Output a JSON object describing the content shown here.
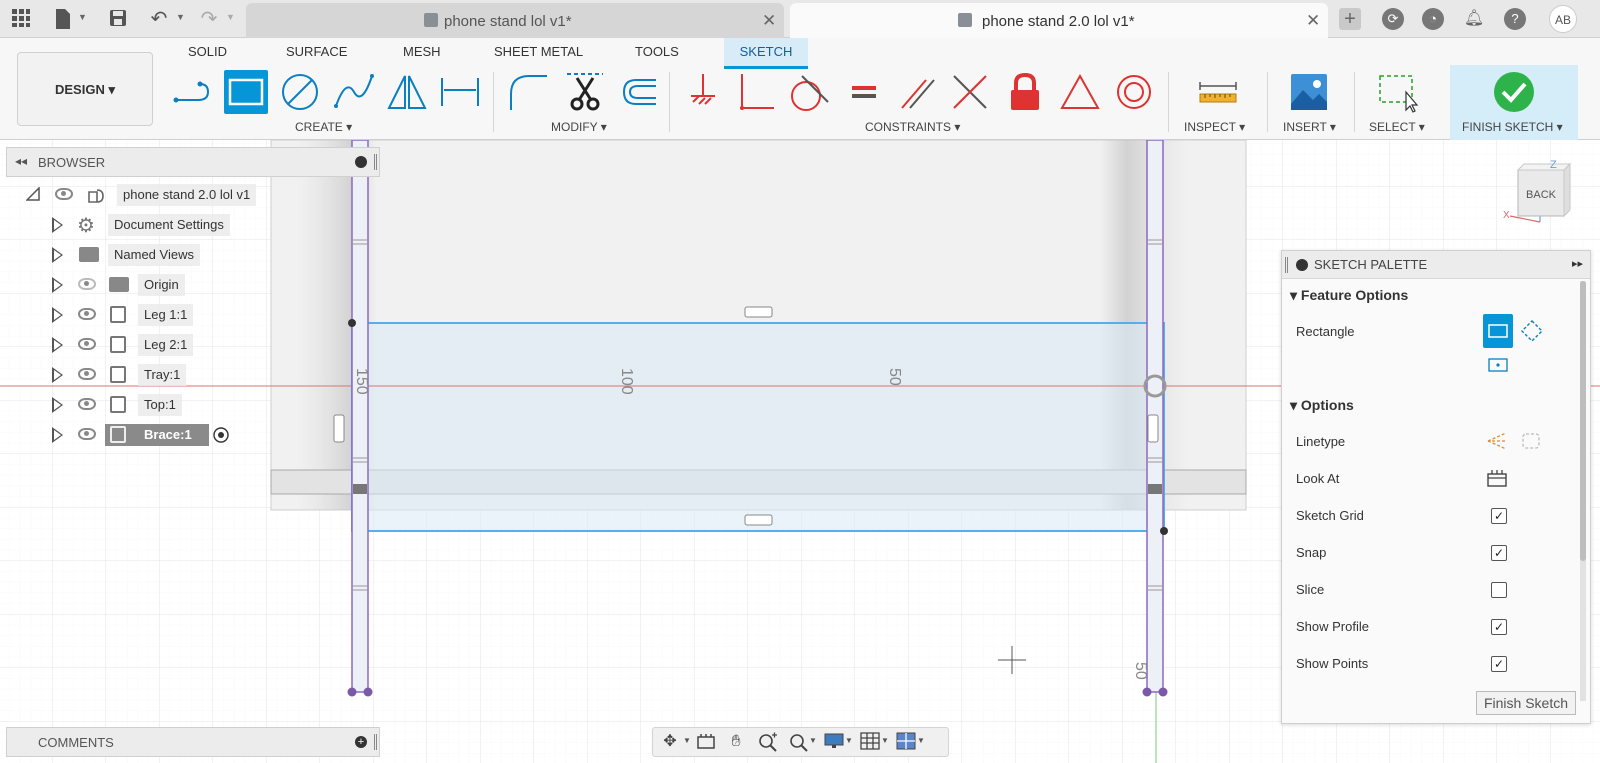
{
  "topbar": {
    "tabs": [
      {
        "title": "phone stand lol v1*",
        "active": false
      },
      {
        "title": "phone stand 2.0 lol v1*",
        "active": true
      }
    ],
    "avatar": "AB"
  },
  "ribbon": {
    "design_label": "DESIGN",
    "tabs": [
      "SOLID",
      "SURFACE",
      "MESH",
      "SHEET METAL",
      "TOOLS",
      "SKETCH"
    ],
    "active_tab": "SKETCH",
    "groups": {
      "create": "CREATE",
      "modify": "MODIFY",
      "constraints": "CONSTRAINTS",
      "inspect": "INSPECT",
      "insert": "INSERT",
      "select": "SELECT",
      "finish": "FINISH SKETCH"
    }
  },
  "browser": {
    "title": "BROWSER",
    "root": "phone stand 2.0 lol v1",
    "items": [
      {
        "label": "Document Settings",
        "icon": "gear-icon"
      },
      {
        "label": "Named Views",
        "icon": "folder-icon"
      },
      {
        "label": "Origin",
        "icon": "folder-icon",
        "hidden": true
      },
      {
        "label": "Leg 1:1",
        "icon": "component-icon"
      },
      {
        "label": "Leg 2:1",
        "icon": "component-icon"
      },
      {
        "label": "Tray:1",
        "icon": "component-icon"
      },
      {
        "label": "Top:1",
        "icon": "component-icon"
      },
      {
        "label": "Brace:1",
        "icon": "component-icon",
        "selected": true
      }
    ]
  },
  "comments": {
    "title": "COMMENTS"
  },
  "viewcube": {
    "face": "BACK",
    "z": "Z",
    "x": "X"
  },
  "canvas": {
    "dim_labels": [
      "150",
      "100",
      "50",
      "50"
    ]
  },
  "palette": {
    "title": "SKETCH PALETTE",
    "section_feature": "Feature Options",
    "rectangle_label": "Rectangle",
    "section_options": "Options",
    "options": [
      {
        "label": "Linetype",
        "type": "icon"
      },
      {
        "label": "Look At",
        "type": "icon"
      },
      {
        "label": "Sketch Grid",
        "checked": true
      },
      {
        "label": "Snap",
        "checked": true
      },
      {
        "label": "Slice",
        "checked": false
      },
      {
        "label": "Show Profile",
        "checked": true
      },
      {
        "label": "Show Points",
        "checked": true
      }
    ],
    "finish_button": "Finish Sketch"
  },
  "colors": {
    "accent": "#0696d7",
    "sketch_line": "#5aaee8",
    "axis_red": "#e07070",
    "axis_green": "#7ec87e",
    "finish_green": "#2db34a",
    "purple": "#8a6bbf"
  }
}
